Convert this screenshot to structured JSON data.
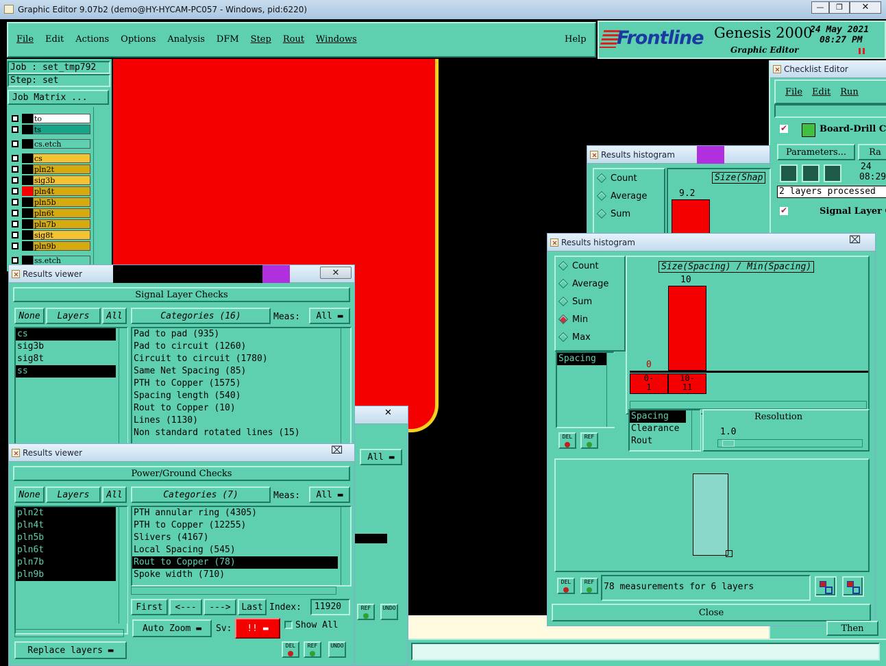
{
  "window": {
    "title": "Graphic Editor 9.07b2 (demo@HY-HYCAM-PC057 - Windows, pid:6220)"
  },
  "menu": {
    "items": [
      "File",
      "Edit",
      "Actions",
      "Options",
      "Analysis",
      "DFM",
      "Step",
      "Rout",
      "Windows"
    ],
    "help": "Help"
  },
  "brand": {
    "logo": "Frontline",
    "product": "Genesis 2000",
    "subtitle": "Graphic Editor",
    "date": "24 May 2021",
    "time": "08:27 PM"
  },
  "job": {
    "job_label": "Job : set_tmp792",
    "step_label": "Step: set",
    "matrix_button": "Job Matrix ..."
  },
  "layers": [
    {
      "name": "to",
      "bg": "#ffffff"
    },
    {
      "name": "ts",
      "bg": "#17a589"
    },
    {
      "name": "cs.etch",
      "bg": "#5ed0b0"
    },
    {
      "name": "cs",
      "bg": "#f4c430"
    },
    {
      "name": "pln2t",
      "bg": "#d4aa10"
    },
    {
      "name": "sig3b",
      "bg": "#f4c430"
    },
    {
      "name": "pln4t",
      "bg": "#d4aa10"
    },
    {
      "name": "pln5b",
      "bg": "#d4aa10"
    },
    {
      "name": "pln6t",
      "bg": "#d4aa10"
    },
    {
      "name": "pln7b",
      "bg": "#d4aa10"
    },
    {
      "name": "sig8t",
      "bg": "#f4c430"
    },
    {
      "name": "pln9b",
      "bg": "#d4aa10"
    },
    {
      "name": "ss.etch",
      "bg": "#5ed0b0"
    }
  ],
  "checklist": {
    "title": "Checklist Editor",
    "menu": [
      "File",
      "Edit",
      "Run"
    ],
    "item1": "Board-Drill Che",
    "params": "Parameters...",
    "ra": "Ra",
    "date": "24",
    "time": "08:29",
    "status": "2 layers processed",
    "item2": "Signal Layer Ch"
  },
  "hist_back": {
    "title": "Results histogram",
    "options": [
      "Count",
      "Average",
      "Sum"
    ],
    "header": "Size(Shap",
    "bar_value": "9.2"
  },
  "hist_front": {
    "title": "Results histogram",
    "options": [
      "Count",
      "Average",
      "Sum",
      "Min",
      "Max"
    ],
    "selected": "Min",
    "header": "Size(Spacing) / Min(Spacing)",
    "bar_value": "10",
    "zero_value": "0",
    "bins": [
      "0-\n1",
      "10-\n11"
    ],
    "measure_list": [
      "Spacing"
    ],
    "type_list": [
      "Spacing",
      "Clearance",
      "Rout"
    ],
    "resolution_label": "Resolution",
    "resolution": "1.0",
    "summary": "78 measurements for 6 layers",
    "close": "Close"
  },
  "rv1": {
    "title": "Results viewer",
    "section": "Signal Layer Checks",
    "none": "None",
    "layers": "Layers",
    "all": "All",
    "categories": "Categories (16)",
    "meas": "Meas:",
    "meas_val": "All",
    "layer_list": [
      {
        "t": "cs",
        "sel": true
      },
      {
        "t": "sig3b",
        "sel": false
      },
      {
        "t": "sig8t",
        "sel": false
      },
      {
        "t": "ss",
        "sel": true
      }
    ],
    "cat_list": [
      "Pad to pad (935)",
      "Pad to circuit (1260)",
      "Circuit to circuit (1780)",
      "Same Net Spacing (85)",
      "PTH to Copper (1575)",
      "Spacing length (540)",
      "Rout to Copper (10)",
      "Lines (1130)",
      "Non standard rotated lines (15)"
    ]
  },
  "rv2": {
    "title": "Results viewer",
    "section": "Power/Ground Checks",
    "none": "None",
    "layers": "Layers",
    "all": "All",
    "categories": "Categories (7)",
    "meas": "Meas:",
    "meas_val": "All",
    "layer_list": [
      "pln2t",
      "pln4t",
      "pln5b",
      "pln6t",
      "pln7b",
      "pln9b"
    ],
    "cat_list": [
      {
        "t": "PTH annular ring (4305)",
        "sel": false
      },
      {
        "t": "PTH to Copper (12255)",
        "sel": false
      },
      {
        "t": "Slivers (4167)",
        "sel": false
      },
      {
        "t": "Local Spacing (545)",
        "sel": false
      },
      {
        "t": "Rout to Copper (78)",
        "sel": true
      },
      {
        "t": "Spoke width (710)",
        "sel": false
      }
    ],
    "first": "First",
    "prev": "<---",
    "next": "--->",
    "last": "Last",
    "index_label": "Index:",
    "index": "11920",
    "zoom": "Auto Zoom",
    "sv": "Sv:",
    "sv_val": "!!",
    "show_all": "Show All",
    "replace": "Replace layers"
  },
  "rv_hidden": {
    "all": "All"
  },
  "misc": {
    "del": "DEL",
    "ref": "REF",
    "undo": "UNDO",
    "then": "Then"
  }
}
